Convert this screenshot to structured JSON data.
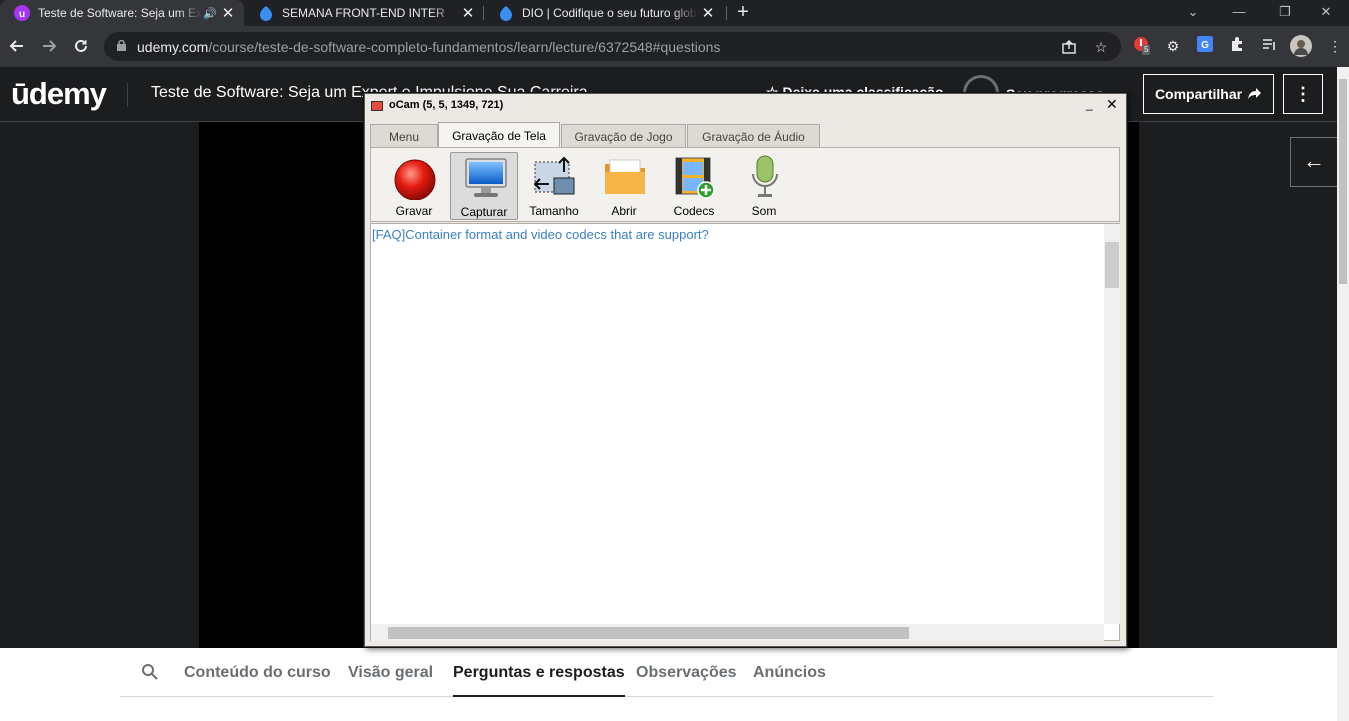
{
  "browser": {
    "tabs": [
      {
        "title": "Teste de Software: Seja um Expert e Impulsione Sua Carreira",
        "favicon": "udemy-icon",
        "active": true,
        "audio": true
      },
      {
        "title": "SEMANA FRONT-END INTER",
        "favicon": "dio-icon",
        "active": false
      },
      {
        "title": "DIO | Codifique o seu futuro global",
        "favicon": "dio-icon",
        "active": false
      }
    ],
    "new_tab": "+",
    "window_controls": {
      "minimize": "⌄",
      "restore": "—",
      "maximize": "❐",
      "close": "✕"
    },
    "url_host": "udemy.com",
    "url_path": "/course/teste-de-software-completo-fundamentos/learn/lecture/6372548#questions",
    "extension_badge": "5",
    "colors": {
      "tabstrip": "#202124",
      "toolbar": "#35363a"
    }
  },
  "udemy": {
    "logo": "ūdemy",
    "course_title": "Teste de Software: Seja um Expert e Impulsione Sua Carreira",
    "rating_label": "Deixe uma classificação",
    "progress_label": "Seu progresso",
    "share_label": "Compartilhar",
    "more_label": "⋮",
    "back_arrow": "←",
    "brand_color": "#a435f0"
  },
  "bottom_tabs": [
    {
      "label": "Conteúdo do curso",
      "active": false
    },
    {
      "label": "Visão geral",
      "active": false
    },
    {
      "label": "Perguntas e respostas",
      "active": true
    },
    {
      "label": "Observações",
      "active": false
    },
    {
      "label": "Anúncios",
      "active": false
    }
  ],
  "ocam": {
    "title": "oCam (5, 5, 1349, 721)",
    "minimize": "_",
    "close": "✕",
    "tabs": [
      {
        "label": "Menu",
        "active": false
      },
      {
        "label": "Gravação de Tela",
        "active": true
      },
      {
        "label": "Gravação de Jogo",
        "active": false
      },
      {
        "label": "Gravação de Áudio",
        "active": false
      }
    ],
    "tools": [
      {
        "label": "Gravar",
        "icon": "record-icon"
      },
      {
        "label": "Capturar",
        "icon": "monitor-icon",
        "selected": true
      },
      {
        "label": "Tamanho",
        "icon": "resize-icon"
      },
      {
        "label": "Abrir",
        "icon": "folder-icon"
      },
      {
        "label": "Codecs",
        "icon": "codecs-icon"
      },
      {
        "label": "Som",
        "icon": "microphone-icon"
      }
    ],
    "faq_link": "[FAQ]Container format and video codecs that are support?"
  }
}
